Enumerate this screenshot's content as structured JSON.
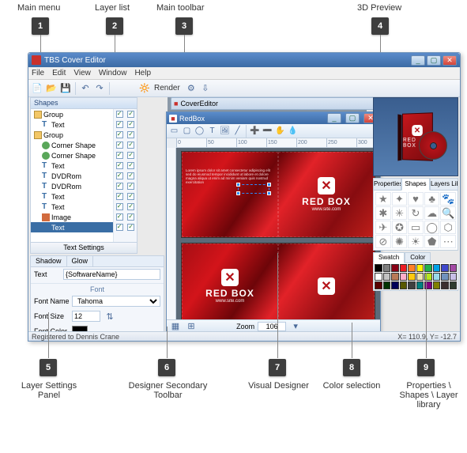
{
  "callouts": {
    "top": [
      {
        "n": "1",
        "label": "Main menu"
      },
      {
        "n": "2",
        "label": "Layer list"
      },
      {
        "n": "3",
        "label": "Main toolbar"
      },
      {
        "n": "4",
        "label": "3D Preview"
      }
    ],
    "bottom": [
      {
        "n": "5",
        "label": "Layer Settings Panel"
      },
      {
        "n": "6",
        "label": "Designer Secondary Toolbar"
      },
      {
        "n": "7",
        "label": "Visual Designer"
      },
      {
        "n": "8",
        "label": "Color selection"
      },
      {
        "n": "9",
        "label": "Properties \\ Shapes \\ Layer library"
      }
    ]
  },
  "window": {
    "title": "TBS Cover Editor",
    "menu": [
      "File",
      "Edit",
      "View",
      "Window",
      "Help"
    ],
    "toolbar": {
      "render_label": "Render"
    },
    "status_left": "Registered to Dennis Crane",
    "status_right": "X= 110.9, Y= -12.7"
  },
  "shapes_panel": {
    "title": "Shapes",
    "text_settings": "Text Settings",
    "layers": [
      {
        "indent": 0,
        "icon": "folder",
        "label": "Group"
      },
      {
        "indent": 1,
        "icon": "t",
        "label": "Text"
      },
      {
        "indent": 0,
        "icon": "folder",
        "label": "Group"
      },
      {
        "indent": 1,
        "icon": "shape",
        "label": "Corner Shape"
      },
      {
        "indent": 1,
        "icon": "shape",
        "label": "Corner Shape"
      },
      {
        "indent": 1,
        "icon": "t",
        "label": "Text"
      },
      {
        "indent": 1,
        "icon": "t",
        "label": "DVDRom"
      },
      {
        "indent": 1,
        "icon": "t",
        "label": "DVDRom"
      },
      {
        "indent": 1,
        "icon": "t",
        "label": "Text"
      },
      {
        "indent": 1,
        "icon": "t",
        "label": "Text"
      },
      {
        "indent": 1,
        "icon": "img",
        "label": "Image"
      },
      {
        "indent": 1,
        "icon": "t",
        "label": "Text",
        "selected": true
      }
    ]
  },
  "settings": {
    "tabs": [
      "Shadow",
      "Glow"
    ],
    "text_label": "Text",
    "text_value": "{SoftwareName}",
    "font_group": "Font",
    "fontname_label": "Font Name",
    "fontname_value": "Tahoma",
    "fontsize_label": "Font Size",
    "fontsize_value": "12",
    "fontcolor_label": "Font Color"
  },
  "designer": {
    "cover_editor_title": "CoverEditor",
    "doc_title": "RedBox",
    "ruler": [
      "0",
      "50",
      "100",
      "150",
      "200",
      "250",
      "300"
    ],
    "brand": "RED BOX",
    "site": "www.site.com",
    "zoom_label": "Zoom",
    "zoom_value": "106"
  },
  "right": {
    "tabs": [
      "Properties",
      "Shapes",
      "Layers Library"
    ],
    "active_tab": 1,
    "shape_glyphs": [
      "★",
      "✦",
      "♥",
      "♣",
      "🐾",
      "✱",
      "✳",
      "↻",
      "☁",
      "🔍",
      "✈",
      "✪",
      "▭",
      "◯",
      "⬡",
      "⊘",
      "✺",
      "☀",
      "⬟",
      "⋯"
    ],
    "swatch_tabs": [
      "Swatch",
      "Color"
    ],
    "swatches": [
      "#000000",
      "#7f7f7f",
      "#880015",
      "#ed1c24",
      "#ff7f27",
      "#fff200",
      "#22b14c",
      "#00a2e8",
      "#3f48cc",
      "#a349a4",
      "#ffffff",
      "#c3c3c3",
      "#b97a57",
      "#ffaec9",
      "#ffc90e",
      "#efe4b0",
      "#b5e61d",
      "#99d9ea",
      "#7092be",
      "#c8bfe7",
      "#580000",
      "#003300",
      "#000058",
      "#585800",
      "#404040",
      "#008080",
      "#800080",
      "#808000",
      "#3c2f2f",
      "#2f3c2f"
    ]
  }
}
